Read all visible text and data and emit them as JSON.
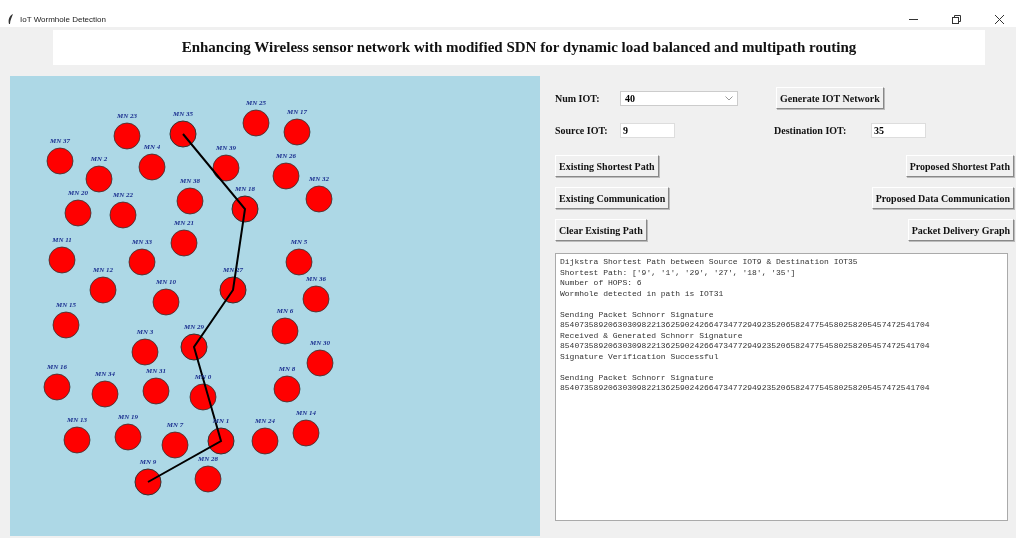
{
  "window": {
    "title": "IoT Wormhole Detection"
  },
  "header": {
    "title": "Enhancing Wireless sensor network with modified SDN for dynamic load balanced and multipath routing"
  },
  "network": {
    "nodes": [
      {
        "label": "MN 23",
        "on_path": false
      },
      {
        "label": "MN 35",
        "on_path": true
      },
      {
        "label": "MN 25",
        "on_path": false
      },
      {
        "label": "MN 17",
        "on_path": false
      },
      {
        "label": "MN 37",
        "on_path": false
      },
      {
        "label": "MN 4",
        "on_path": false
      },
      {
        "label": "MN 39",
        "on_path": false
      },
      {
        "label": "MN 26",
        "on_path": false
      },
      {
        "label": "MN 2",
        "on_path": false
      },
      {
        "label": "MN 32",
        "on_path": false
      },
      {
        "label": "MN 38",
        "on_path": false
      },
      {
        "label": "MN 18",
        "on_path": true
      },
      {
        "label": "MN 20",
        "on_path": false
      },
      {
        "label": "MN 22",
        "on_path": false
      },
      {
        "label": "MN 21",
        "on_path": false
      },
      {
        "label": "MN 11",
        "on_path": false
      },
      {
        "label": "MN 33",
        "on_path": false
      },
      {
        "label": "MN 5",
        "on_path": false
      },
      {
        "label": "MN 12",
        "on_path": false
      },
      {
        "label": "MN 10",
        "on_path": false
      },
      {
        "label": "MN 27",
        "on_path": true
      },
      {
        "label": "MN 36",
        "on_path": false
      },
      {
        "label": "MN 15",
        "on_path": false
      },
      {
        "label": "MN 6",
        "on_path": false
      },
      {
        "label": "MN 3",
        "on_path": false
      },
      {
        "label": "MN 29",
        "on_path": true
      },
      {
        "label": "MN 30",
        "on_path": false
      },
      {
        "label": "MN 16",
        "on_path": false
      },
      {
        "label": "MN 34",
        "on_path": false
      },
      {
        "label": "MN 31",
        "on_path": false
      },
      {
        "label": "MN 0",
        "on_path": false
      },
      {
        "label": "MN 8",
        "on_path": false
      },
      {
        "label": "MN 13",
        "on_path": false
      },
      {
        "label": "MN 19",
        "on_path": false
      },
      {
        "label": "MN 7",
        "on_path": false
      },
      {
        "label": "MN 1",
        "on_path": true
      },
      {
        "label": "MN 24",
        "on_path": false
      },
      {
        "label": "MN 14",
        "on_path": false
      },
      {
        "label": "MN 9",
        "on_path": true
      },
      {
        "label": "MN 28",
        "on_path": false
      }
    ]
  },
  "controls": {
    "num_iot": {
      "label": "Num IOT:",
      "value": "40"
    },
    "generate_button": "Generate IOT Network",
    "source": {
      "label": "Source IOT:",
      "value": "9"
    },
    "destination": {
      "label": "Destination IOT:",
      "value": "35"
    },
    "buttons_left": [
      "Existing Shortest Path",
      "Existing Communication",
      "Clear Existing Path"
    ],
    "buttons_right": [
      "Proposed Shortest Path",
      "Proposed Data Communication",
      "Packet Delivery Graph"
    ]
  },
  "log": {
    "blocks": [
      [
        "Dijkstra Shortest Path between Source IOT9 & Destination IOT35",
        "Shortest Path: ['9', '1', '29', '27', '18', '35']",
        "Number of HOPS: 6",
        "Wormhole detected in path is IOT31"
      ],
      [
        "Sending Packet Schnorr Signature",
        "85407358920630309822136259024266473477294923520658247754580258205457472541704",
        "Received & Generated Schnorr Signature",
        "85407358920630309822136259024266473477294923520658247754580258205457472541704",
        "Signature Verification Successful"
      ],
      [
        "Sending Packet Schnorr Signature",
        "85407358920630309822136259024266473477294923520658247754580258205457472541704"
      ]
    ]
  }
}
